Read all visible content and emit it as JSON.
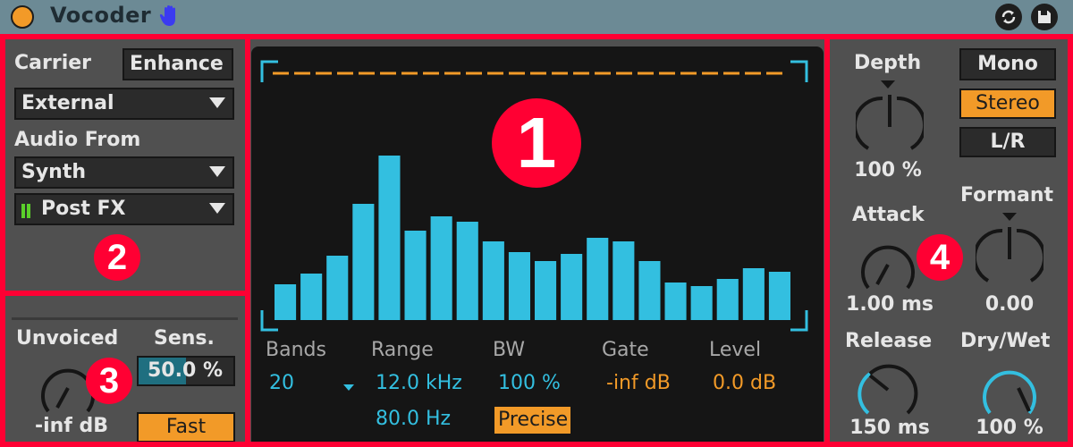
{
  "titlebar": {
    "title": "Vocoder",
    "icons": [
      "power-icon",
      "hand-icon",
      "hot-swap-icon",
      "save-preset-icon"
    ]
  },
  "colors": {
    "accent_blue": "#33bfe0",
    "accent_orange": "#f29a28",
    "annotation_red": "#ff0033",
    "title_bar": "#6c8a95",
    "panel": "#505050",
    "display": "#151515"
  },
  "annotations": [
    "1",
    "2",
    "3",
    "4"
  ],
  "carrier": {
    "label": "Carrier",
    "enhance_label": "Enhance",
    "carrier_select": "External",
    "audio_from_label": "Audio From",
    "audio_from_select": "Synth",
    "tap_select": "Post FX"
  },
  "unvoiced": {
    "unvoiced_label": "Unvoiced",
    "unvoiced_value": "-inf dB",
    "sens_label": "Sens.",
    "sens_value": "50.0 %",
    "sens_fraction": 0.5,
    "fast_label": "Fast"
  },
  "display": {
    "bands_label": "Bands",
    "bands_value": "20",
    "range_label": "Range",
    "range_high": "12.0 kHz",
    "range_low": "80.0 Hz",
    "bw_label": "BW",
    "bw_value": "100 %",
    "precise_label": "Precise",
    "gate_label": "Gate",
    "gate_value": "-inf dB",
    "level_label": "Level",
    "level_value": "0.0 dB",
    "band_levels": [
      0.2,
      0.26,
      0.36,
      0.65,
      0.92,
      0.5,
      0.58,
      0.55,
      0.44,
      0.38,
      0.33,
      0.37,
      0.46,
      0.44,
      0.33,
      0.21,
      0.19,
      0.23,
      0.29,
      0.27
    ]
  },
  "right": {
    "depth_label": "Depth",
    "depth_value": "100 %",
    "mono_label": "Mono",
    "stereo_label": "Stereo",
    "lr_label": "L/R",
    "attack_label": "Attack",
    "attack_value": "1.00 ms",
    "formant_label": "Formant",
    "formant_value": "0.00",
    "release_label": "Release",
    "release_value": "150 ms",
    "drywet_label": "Dry/Wet",
    "drywet_value": "100 %"
  }
}
